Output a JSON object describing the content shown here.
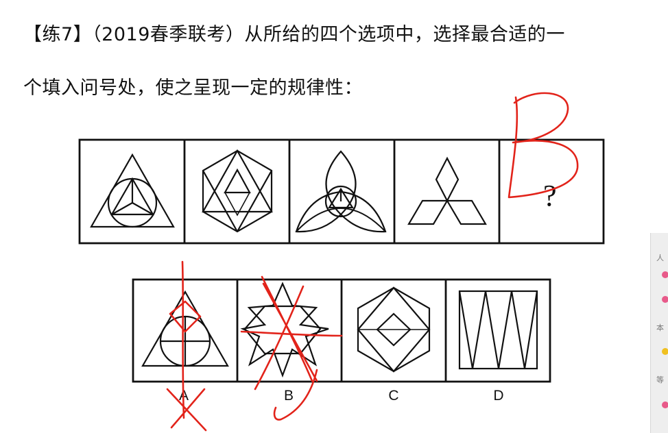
{
  "question": {
    "line1": "【练7】（2019春季联考）从所给的四个选项中，选择最合适的一",
    "line2": "个填入问号处，使之呈现一定的规律性："
  },
  "question_mark": "?",
  "options": [
    {
      "label": "A"
    },
    {
      "label": "B"
    },
    {
      "label": "C"
    },
    {
      "label": "D"
    }
  ],
  "handwritten_answer": "B",
  "side_panel": {
    "texts": [
      "人",
      "本",
      "等"
    ],
    "dot_colors": [
      "#e85a8a",
      "#e85a8a",
      "#f0c020",
      "#e85a8a"
    ]
  },
  "colors": {
    "ink": "#111111",
    "annotation": "#e2231a"
  }
}
